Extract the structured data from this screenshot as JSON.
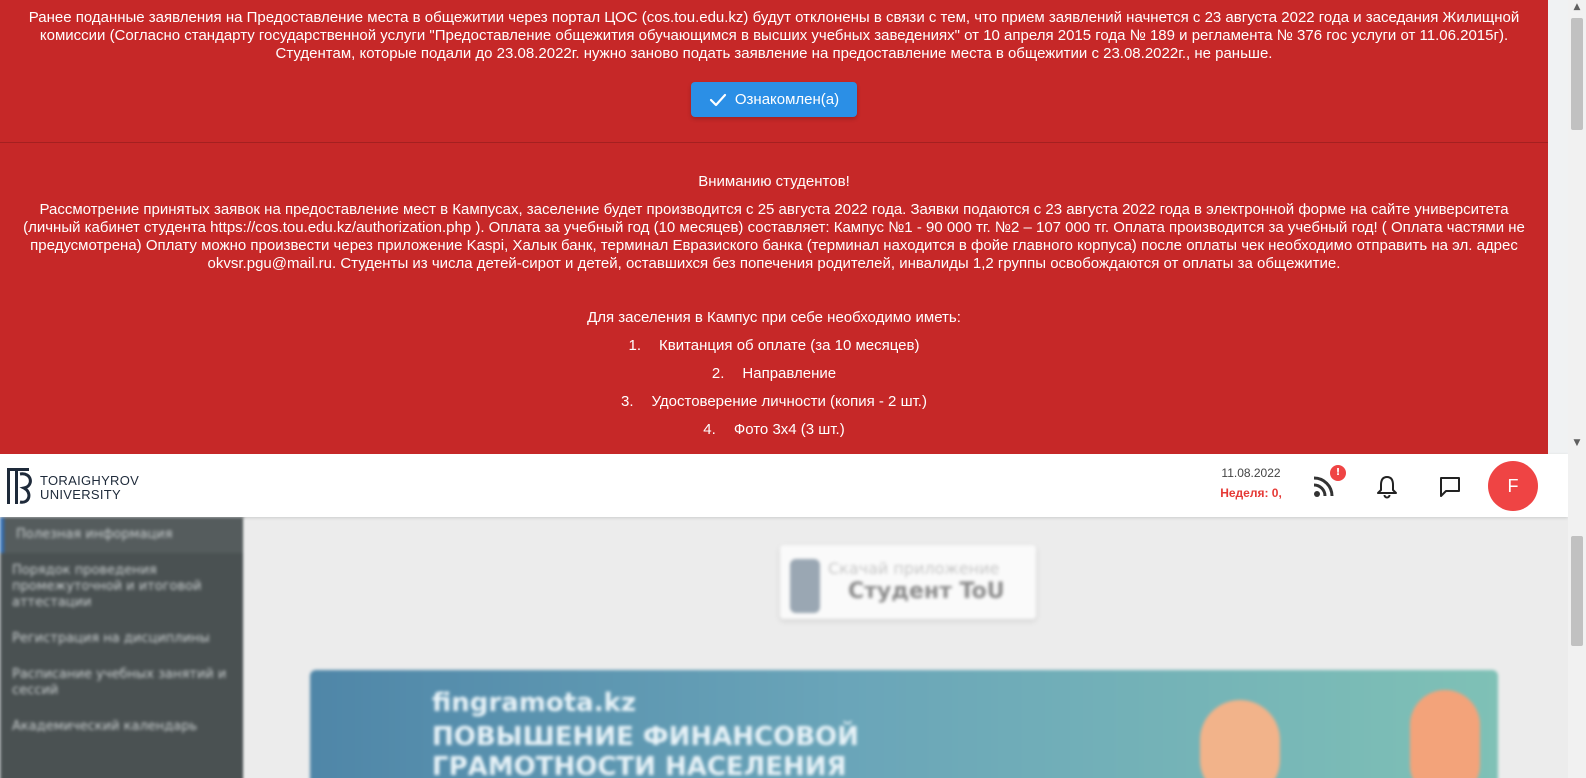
{
  "announcement": {
    "notice_text": "Ранее поданные заявления на Предоставление места в общежитии через портал ЦОС (cos.tou.edu.kz) будут отклонены в связи с тем, что прием заявлений начнется с 23 августа 2022 года и заседания Жилищной комиссии (Согласно стандарту государственной услуги \"Предоставление общежития обучающимся в высших учебных заведениях\" от 10 апреля 2015 года № 189 и регламента  № 376 гос услуги от 11.06.2015г). Студентам, которые подали до 23.08.2022г. нужно заново подать заявление на предоставление места в общежитии с 23.08.2022г., не раньше.",
    "ack_button_label": "Ознакомлен(а)",
    "attention_title": "Вниманию студентов!",
    "attention_body": "Рассмотрение принятых заявок на предоставление мест в Кампусах, заселение будет производится с 25 августа 2022 года. Заявки подаются с 23 августа 2022 года в электронной форме на сайте университета (личный кабинет студента https://cos.tou.edu.kz/authorization.php ). Оплата за учебный год (10 месяцев) составляет: Кампус №1 -  90 000 тг. №2 – 107 000 тг. Оплата производится за учебный год! ( Оплата частями не предусмотрена) Оплату можно произвести через приложение Kaspi, Халык банк, терминал Евразиского банка (терминал находится в фойе главного корпуса) после оплаты чек необходимо отправить на эл. адрес  okvsr.pgu@mail.ru. Студенты из числа детей-сирот и детей, оставшихся без попечения родителей, инвалиды 1,2 группы освобождаются от оплаты за общежитие.",
    "requirements_title": "Для заселения в Кампус при себе необходимо иметь:",
    "requirements": [
      {
        "num": "1.",
        "text": "Квитанция об оплате (за 10 месяцев)"
      },
      {
        "num": "2.",
        "text": "Направление"
      },
      {
        "num": "3.",
        "text": "Удостоверение личности (копия - 2 шт.)"
      },
      {
        "num": "4.",
        "text": "Фото 3х4 (3 шт.)"
      }
    ]
  },
  "header": {
    "logo_line1": "TORAIGHYROV",
    "logo_line2": "UNIVERSITY",
    "date": "11.08.2022",
    "week": "Неделя: 0,",
    "rss_badge": "!",
    "avatar_letter": "F",
    "icons": [
      "rss-icon",
      "bell-icon",
      "chat-icon"
    ]
  },
  "sidebar": {
    "items": [
      {
        "label": "Полезная информация"
      },
      {
        "label": "Порядок проведения промежуточной и итоговой аттестации"
      },
      {
        "label": "Регистрация на дисциплины"
      },
      {
        "label": "Расписание учебных занятий и сессий"
      },
      {
        "label": "Академический календарь"
      }
    ]
  },
  "main": {
    "app_promo_sub": "Скачай приложение",
    "app_promo_main": "Студент ToU",
    "banner_site": "fingramota.kz",
    "banner_title": "ПОВЫШЕНИЕ ФИНАНСОВОЙ ГРАМОТНОСТИ НАСЕЛЕНИЯ"
  },
  "colors": {
    "announcement_bg": "#c62828",
    "button_blue": "#2b8fe6",
    "badge_red": "#ef4444",
    "week_red": "#e53935"
  }
}
